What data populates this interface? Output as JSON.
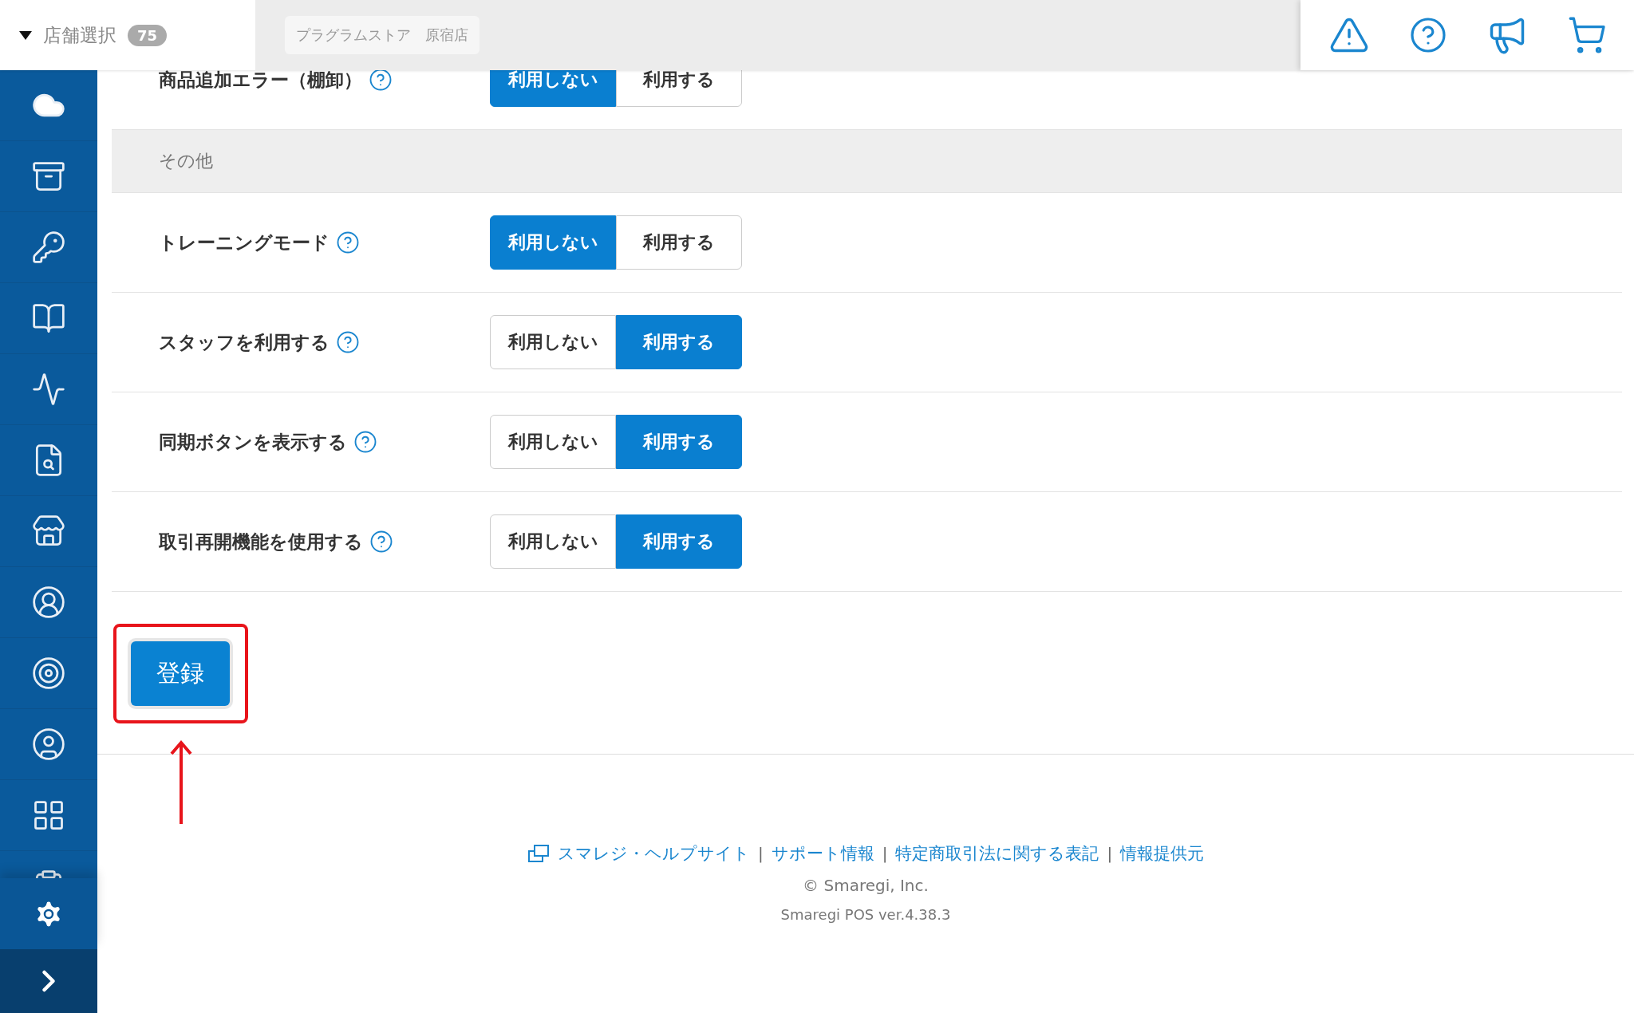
{
  "header": {
    "store_selector": {
      "label": "店舗選択",
      "count": "75"
    },
    "store_name": "プラグラムストア　原宿店"
  },
  "settings": {
    "top_row": {
      "label": "商品追加エラー（棚卸）",
      "options": [
        {
          "label": "利用しない",
          "selected": true
        },
        {
          "label": "利用する",
          "selected": false
        }
      ]
    },
    "section": {
      "title": "その他",
      "rows": [
        {
          "label": "トレーニングモード",
          "options": [
            {
              "label": "利用しない",
              "selected": true
            },
            {
              "label": "利用する",
              "selected": false
            }
          ]
        },
        {
          "label": "スタッフを利用する",
          "options": [
            {
              "label": "利用しない",
              "selected": false
            },
            {
              "label": "利用する",
              "selected": true
            }
          ]
        },
        {
          "label": "同期ボタンを表示する",
          "options": [
            {
              "label": "利用しない",
              "selected": false
            },
            {
              "label": "利用する",
              "selected": true
            }
          ]
        },
        {
          "label": "取引再開機能を使用する",
          "options": [
            {
              "label": "利用しない",
              "selected": false
            },
            {
              "label": "利用する",
              "selected": true
            }
          ]
        }
      ]
    }
  },
  "submit_button": {
    "label": "登録"
  },
  "footer": {
    "links": [
      "スマレジ・ヘルプサイト",
      "サポート情報",
      "特定商取引法に関する表記",
      "情報提供元"
    ],
    "separator": "|",
    "copyright": "© Smaregi, Inc.",
    "version": "Smaregi POS ver.4.38.3"
  }
}
